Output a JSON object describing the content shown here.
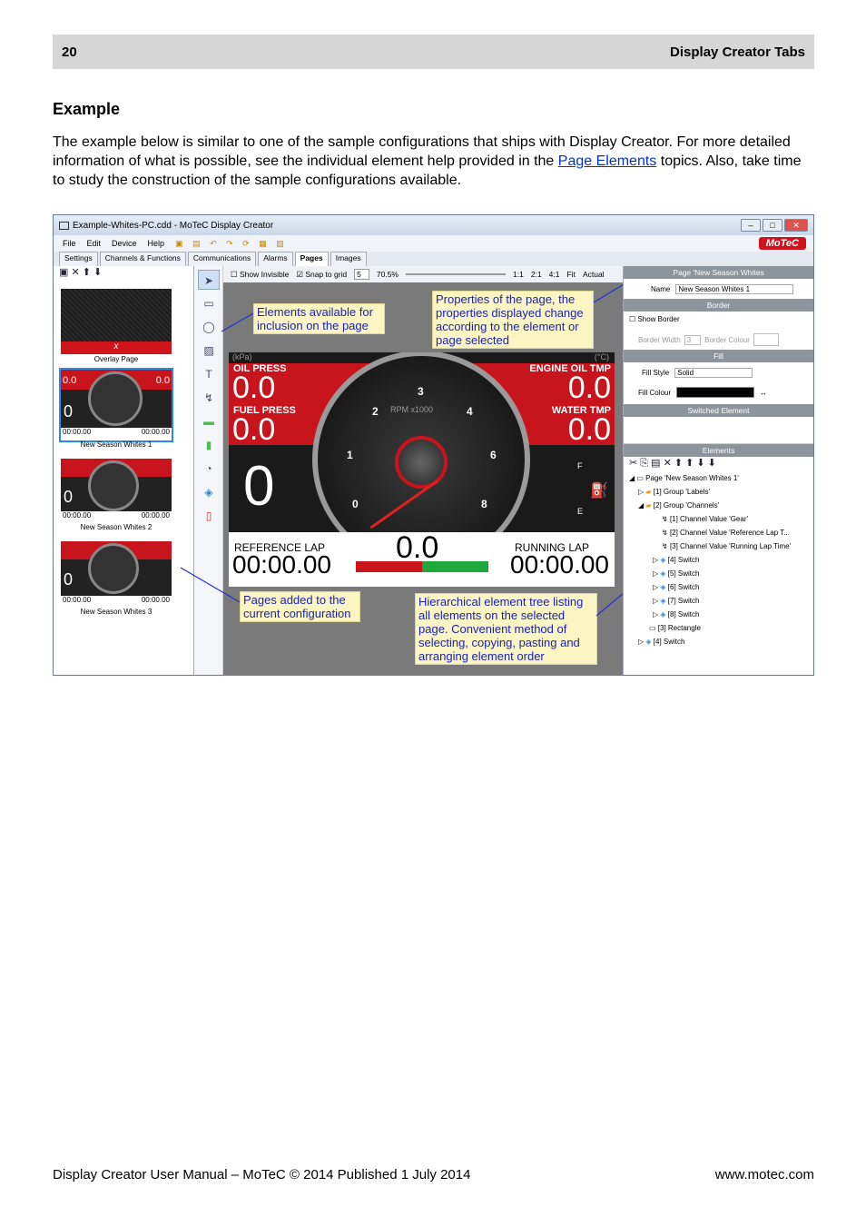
{
  "header": {
    "page_number": "20",
    "section": "Display Creator Tabs"
  },
  "heading": "Example",
  "intro": {
    "before_link": "The example below is similar to one of the sample configurations that ships with Display Creator. For more detailed information of what is possible, see the individual element help provided in the ",
    "link": "Page Elements",
    "after_link": " topics. Also, take time to study the construction of the sample configurations available."
  },
  "screenshot": {
    "title": "Example-Whites-PC.cdd - MoTeC Display Creator",
    "menu": [
      "File",
      "Edit",
      "Device",
      "Help"
    ],
    "brand": "MoTeC",
    "tabs": [
      "Settings",
      "Channels & Functions",
      "Communications",
      "Alarms",
      "Pages",
      "Images"
    ],
    "toolbar": {
      "show_invisible": "Show Invisible",
      "snap": "Snap to grid",
      "snap_value": "5",
      "zoom": "70.5%",
      "z1": "1:1",
      "z2": "2:1",
      "z3": "4:1",
      "fit": "Fit",
      "actual": "Actual"
    },
    "pages": [
      {
        "label": "Overlay Page",
        "x": "x"
      },
      {
        "label": "New Season Whites 1"
      },
      {
        "label": "New Season Whites 2"
      },
      {
        "label": "New Season Whites 3"
      }
    ],
    "thumb_values": {
      "v": "0.0",
      "big": "0",
      "time": "00:00.00"
    },
    "dash": {
      "unit_left": "(kPa)",
      "unit_right": "(°C)",
      "oil_press": "OIL PRESS",
      "engine_oil": "ENGINE OIL TMP",
      "fuel_press": "FUEL PRESS",
      "water": "WATER TMP",
      "value": "0.0",
      "gear": "0",
      "rpm": "RPM x1000",
      "ticks": [
        "0",
        "1",
        "2",
        "3",
        "4",
        "6",
        "8"
      ],
      "ref_lap": "REFERENCE LAP",
      "running_lap": "RUNNING LAP",
      "time": "00:00.00",
      "center": "0.0",
      "fuel_f": "F",
      "fuel_e": "E"
    },
    "notes": {
      "elements": "Elements available for inclusion on the page",
      "properties": "Properties of the page, the properties displayed change according to the element or page selected",
      "pages": "Pages added to the current configuration",
      "tree": "Hierarchical element tree listing all elements on the selected page. Convenient method of selecting, copying, pasting and arranging element order"
    },
    "props": {
      "page_hdr": "Page 'New Season Whites",
      "name_label": "Name",
      "name_value": "New Season Whites 1",
      "border_hdr": "Border",
      "show_border": "Show Border",
      "border_width": "Border Width",
      "border_width_val": "3",
      "border_colour": "Border Colour",
      "fill_hdr": "Fill",
      "fill_style": "Fill Style",
      "fill_style_val": "Solid",
      "fill_colour": "Fill Colour",
      "switched_hdr": "Switched Element",
      "elements_hdr": "Elements"
    },
    "tree": [
      "Page 'New Season Whites 1'",
      "[1] Group 'Labels'",
      "[2] Group 'Channels'",
      "[1] Channel Value 'Gear'",
      "[2] Channel Value 'Reference Lap T...",
      "[3] Channel Value 'Running Lap Time'",
      "[4] Switch",
      "[5] Switch",
      "[6] Switch",
      "[7] Switch",
      "[8] Switch",
      "[3] Rectangle",
      "[4] Switch"
    ]
  },
  "footer": {
    "left": "Display Creator User Manual – MoTeC © 2014 Published 1 July 2014",
    "right": "www.motec.com"
  }
}
